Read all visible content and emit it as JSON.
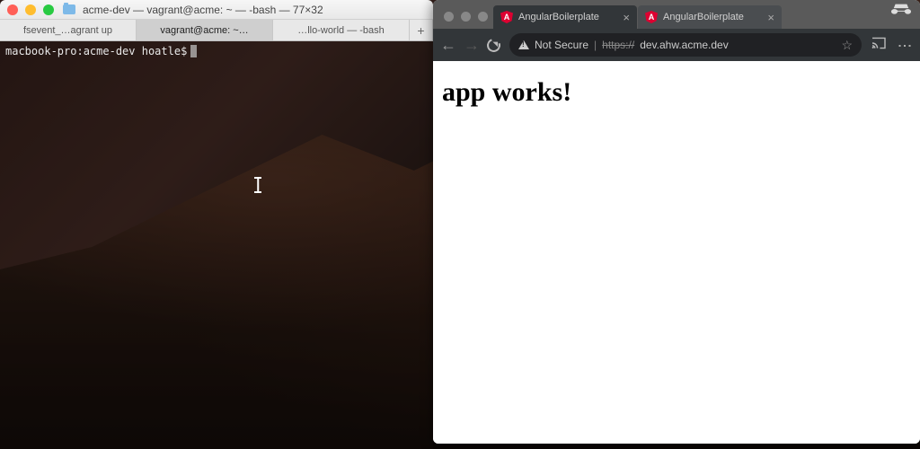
{
  "terminal": {
    "window_title": "acme-dev — vagrant@acme: ~ — -bash — 77×32",
    "tabs": [
      {
        "label": "fsevent_…agrant up"
      },
      {
        "label": "vagrant@acme: ~…"
      },
      {
        "label": "…llo-world — -bash"
      }
    ],
    "add_tab": "+",
    "prompt": "macbook-pro:acme-dev hoatle$"
  },
  "browser": {
    "tabs": [
      {
        "title": "AngularBoilerplate",
        "close": "×"
      },
      {
        "title": "AngularBoilerplate",
        "close": "×"
      }
    ],
    "address": {
      "not_secure": "Not Secure",
      "scheme": "https://",
      "host": "dev.ahw.acme.dev"
    },
    "page": {
      "heading": "app works!"
    }
  }
}
